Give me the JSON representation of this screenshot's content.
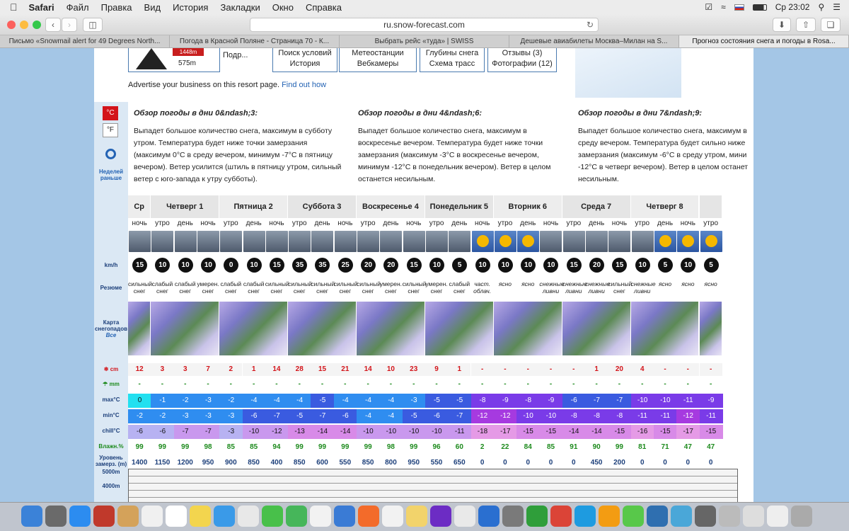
{
  "menubar": {
    "apple": "",
    "app": "Safari",
    "items": [
      "Файл",
      "Правка",
      "Вид",
      "История",
      "Закладки",
      "Окно",
      "Справка"
    ],
    "clock": "Ср 23:02"
  },
  "toolbar": {
    "url": "ru.snow-forecast.com"
  },
  "tabs": [
    "Письмо «Snowmail alert for 49 Degrees North...",
    "Погода в Красной Поляне - Страница 70 - К...",
    "Выбрать рейс «туда» | SWISS",
    "Дешевые авиабилеты Москва–Милан на S...",
    "Прогноз состояния снега и погоды в Rosa..."
  ],
  "header": {
    "elev_top": "1448m",
    "elev_bottom": "575m",
    "podr": "Подр...",
    "btn1_top": "Поиск условий",
    "btn1_bottom": "История",
    "btn2_top": "Метеостанции",
    "btn2_bottom": "Вебкамеры",
    "btn3_top": "Глубины снега",
    "btn3_bottom": "Схема трасс",
    "btn4_top": "Отзывы (3)",
    "btn4_bottom": "Фотографии (12)"
  },
  "advert": {
    "text": "Advertise your business on this resort page. ",
    "link": "Find out how"
  },
  "left": {
    "c": "°C",
    "f": "°F",
    "prev": "Неделей раньше"
  },
  "summary": [
    {
      "title": "Обзор погоды в дни 0&ndash;3:",
      "text": "Выпадет большое количество снега, максимум в субботу утром. Температура будет ниже точки замерзания (максимум 0°C в среду вечером, минимум -7°C в пятницу вечером). Ветер усилится (штиль в пятницу утром, сильный ветер с юго-запада к утру субботы)."
    },
    {
      "title": "Обзор погоды в дни 4&ndash;6:",
      "text": "Выпадет большое количество снега, максимум в воскресенье вечером. Температура будет ниже точки замерзания (максимум -3°C в воскресенье вечером, минимум -12°C в понедельник вечером). Ветер в целом останется несильным."
    },
    {
      "title": "Обзор погоды в дни 7&ndash;9:",
      "text": "Выпадет большое количество снега, максимум в среду вечером. Температура будет сильно ниже замерзания (максимум -6°C в среду утром, мини -12°C в четверг вечером). Ветер в целом останет несильным."
    }
  ],
  "labels": {
    "kmh": "km/h",
    "summary": "Резюме",
    "snowmap": "Карта снегопадов",
    "snowmap_all": "Все",
    "cm": "cm",
    "mm": "mm",
    "max": "max°C",
    "min": "min°C",
    "chill": "chill°C",
    "hum": "Влажн.%",
    "freeze": "Уровень замерз. (m)",
    "m5000": "5000m",
    "m4000": "4000m"
  },
  "days": [
    {
      "name": "Ср",
      "span": 1
    },
    {
      "name": "Четверг 1",
      "span": 3
    },
    {
      "name": "Пятница 2",
      "span": 3
    },
    {
      "name": "Суббота 3",
      "span": 3
    },
    {
      "name": "Воскресенье 4",
      "span": 3
    },
    {
      "name": "Понедельник 5",
      "span": 3
    },
    {
      "name": "Вторник 6",
      "span": 3
    },
    {
      "name": "Среда 7",
      "span": 3
    },
    {
      "name": "Четверг 8",
      "span": 3
    },
    {
      "name": "",
      "span": 1
    }
  ],
  "periods": [
    "ночь",
    "утро",
    "день",
    "ночь",
    "утро",
    "день",
    "ночь",
    "утро",
    "день",
    "ночь",
    "утро",
    "день",
    "ночь",
    "утро",
    "день",
    "ночь",
    "утро",
    "день",
    "ночь",
    "утро",
    "день",
    "ночь",
    "утро",
    "день",
    "ночь",
    "утро"
  ],
  "wind": [
    "15",
    "10",
    "10",
    "10",
    "0",
    "10",
    "15",
    "35",
    "35",
    "25",
    "20",
    "20",
    "15",
    "10",
    "5",
    "10",
    "10",
    "10",
    "10",
    "15",
    "20",
    "15",
    "10",
    "5",
    "10",
    "5"
  ],
  "summary_row": [
    "сильный снег",
    "слабый снег",
    "слабый снег",
    "умерен. снег",
    "слабый снег",
    "слабый снег",
    "сильный снег",
    "сильный снег",
    "сильный снег",
    "сильный снег",
    "сильный снег",
    "умерен. снег",
    "сильный снег",
    "умерен. снег",
    "слабый снег",
    "част. облач.",
    "ясно",
    "ясно",
    "снежные ливни",
    "снежные ливни",
    "снежные ливни",
    "сильный снег",
    "снежные ливни",
    "ясно",
    "ясно",
    "ясно"
  ],
  "snow_cm": [
    "12",
    "3",
    "3",
    "7",
    "2",
    "1",
    "14",
    "28",
    "15",
    "21",
    "14",
    "10",
    "23",
    "9",
    "1",
    "-",
    "-",
    "-",
    "-",
    "-",
    "1",
    "20",
    "4",
    "-",
    "-",
    "-"
  ],
  "rain_mm": [
    "-",
    "-",
    "-",
    "-",
    "-",
    "-",
    "-",
    "-",
    "-",
    "-",
    "-",
    "-",
    "-",
    "-",
    "-",
    "-",
    "-",
    "-",
    "-",
    "-",
    "-",
    "-",
    "-",
    "-",
    "-",
    "-"
  ],
  "tmax": [
    "0",
    "-1",
    "-2",
    "-3",
    "-2",
    "-4",
    "-4",
    "-4",
    "-5",
    "-4",
    "-4",
    "-4",
    "-3",
    "-5",
    "-5",
    "-8",
    "-9",
    "-8",
    "-9",
    "-6",
    "-7",
    "-7",
    "-10",
    "-10",
    "-11",
    "-9"
  ],
  "tmin": [
    "-2",
    "-2",
    "-3",
    "-3",
    "-3",
    "-6",
    "-7",
    "-5",
    "-7",
    "-6",
    "-4",
    "-4",
    "-5",
    "-6",
    "-7",
    "-12",
    "-12",
    "-10",
    "-10",
    "-8",
    "-8",
    "-8",
    "-11",
    "-11",
    "-12",
    "-11"
  ],
  "chill": [
    "-6",
    "-6",
    "-7",
    "-7",
    "-3",
    "-10",
    "-12",
    "-13",
    "-14",
    "-14",
    "-10",
    "-10",
    "-10",
    "-10",
    "-11",
    "-18",
    "-17",
    "-15",
    "-15",
    "-14",
    "-14",
    "-15",
    "-16",
    "-15",
    "-17",
    "-15"
  ],
  "humidity": [
    "99",
    "99",
    "99",
    "98",
    "85",
    "85",
    "94",
    "99",
    "99",
    "99",
    "99",
    "98",
    "99",
    "96",
    "60",
    "2",
    "22",
    "84",
    "85",
    "91",
    "90",
    "99",
    "81",
    "71",
    "47",
    "47"
  ],
  "freezing": [
    "1400",
    "1150",
    "1200",
    "950",
    "900",
    "850",
    "400",
    "850",
    "600",
    "550",
    "850",
    "800",
    "950",
    "550",
    "650",
    "0",
    "0",
    "0",
    "0",
    "0",
    "450",
    "200",
    "0",
    "0",
    "0",
    "0"
  ],
  "colors": {
    "accent": "#2463b4",
    "bg": "#a4c6e6",
    "sun": "#f5b800"
  }
}
